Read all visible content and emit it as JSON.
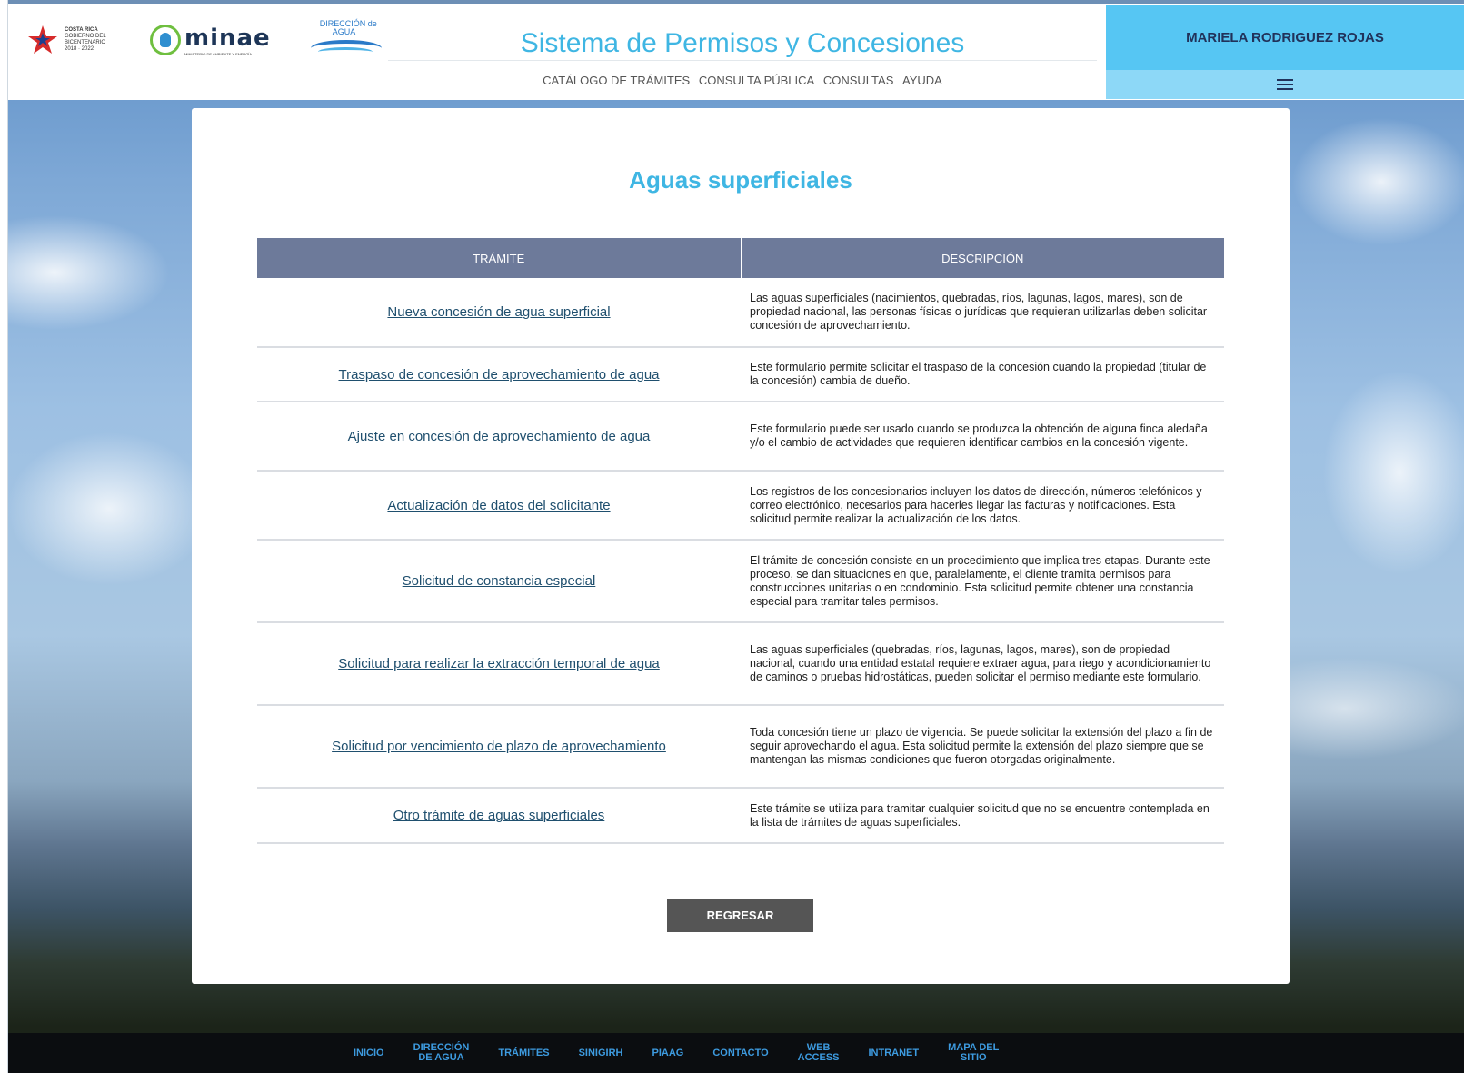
{
  "header": {
    "logos": {
      "cr_line1": "COSTA RICA",
      "cr_line2": "GOBIERNO DEL BICENTENARIO",
      "cr_line3": "2018 · 2022",
      "minae": "minae",
      "minae_sub": "MINISTERIO DE AMBIENTE Y ENERGÍA",
      "da_line1": "DIRECCIÓN de",
      "da_line2": "AGUA"
    },
    "title": "Sistema de Permisos y Concesiones",
    "nav": [
      "CATÁLOGO DE TRÁMITES",
      "CONSULTA PÚBLICA",
      "CONSULTAS",
      "AYUDA"
    ],
    "user_name": "MARIELA RODRIGUEZ ROJAS"
  },
  "main": {
    "page_title": "Aguas superficiales",
    "columns": [
      "TRÁMITE",
      "DESCRIPCIÓN"
    ],
    "rows": [
      {
        "tramite": "Nueva concesión de agua superficial",
        "descripcion": "Las aguas superficiales (nacimientos, quebradas, ríos, lagunas, lagos, mares), son de propiedad nacional, las personas físicas o jurídicas que requieran utilizarlas deben solicitar concesión de aprovechamiento."
      },
      {
        "tramite": "Traspaso de concesión de aprovechamiento de agua",
        "descripcion": "Este formulario permite solicitar el traspaso de la concesión cuando la propiedad (titular de la concesión) cambia de dueño."
      },
      {
        "tramite": "Ajuste en concesión de aprovechamiento de agua",
        "descripcion": "Este formulario puede ser usado cuando se produzca la obtención de alguna finca aledaña y/o el cambio de actividades que requieren identificar cambios en la concesión vigente."
      },
      {
        "tramite": "Actualización de datos del solicitante",
        "descripcion": "Los registros de los concesionarios incluyen los datos de dirección, números telefónicos y correo electrónico, necesarios para hacerles llegar las facturas y notificaciones. Esta solicitud permite realizar la actualización de los datos."
      },
      {
        "tramite": "Solicitud de constancia especial",
        "descripcion": "El trámite de concesión consiste en un procedimiento que implica tres etapas. Durante este proceso, se dan situaciones en que, paralelamente, el cliente tramita permisos para construcciones unitarias o en condominio. Esta solicitud permite obtener una constancia especial para tramitar tales permisos."
      },
      {
        "tramite": "Solicitud para realizar la extracción temporal de agua",
        "descripcion": "Las aguas superficiales (quebradas, ríos, lagunas, lagos, mares), son de propiedad nacional, cuando una entidad estatal requiere extraer agua, para riego y acondicionamiento de caminos o pruebas hidrostáticas, pueden solicitar el permiso mediante este formulario."
      },
      {
        "tramite": "Solicitud por vencimiento de plazo de aprovechamiento",
        "descripcion": "Toda concesión tiene un plazo de vigencia. Se puede solicitar la extensión del plazo a fin de seguir aprovechando el agua. Esta solicitud permite la extensión del plazo siempre que se mantengan las mismas condiciones que fueron otorgadas originalmente."
      },
      {
        "tramite": "Otro trámite de aguas superficiales",
        "descripcion": "Este trámite se utiliza para tramitar cualquier solicitud que no se encuentre contemplada en la lista de trámites de aguas superficiales."
      }
    ],
    "back_button": "REGRESAR"
  },
  "footer": {
    "links": [
      {
        "l1": "INICIO",
        "l2": ""
      },
      {
        "l1": "DIRECCIÓN",
        "l2": "DE AGUA"
      },
      {
        "l1": "TRÁMITES",
        "l2": ""
      },
      {
        "l1": "SINIGIRH",
        "l2": ""
      },
      {
        "l1": "PIAAG",
        "l2": ""
      },
      {
        "l1": "CONTACTO",
        "l2": ""
      },
      {
        "l1": "WEB",
        "l2": "ACCESS"
      },
      {
        "l1": "INTRANET",
        "l2": ""
      },
      {
        "l1": "MAPA DEL",
        "l2": "SITIO"
      }
    ]
  },
  "colors": {
    "accent": "#3fb6e3",
    "user_box": "#56c6f3",
    "table_header": "#6d7a9a",
    "link": "#1f4f6e"
  }
}
